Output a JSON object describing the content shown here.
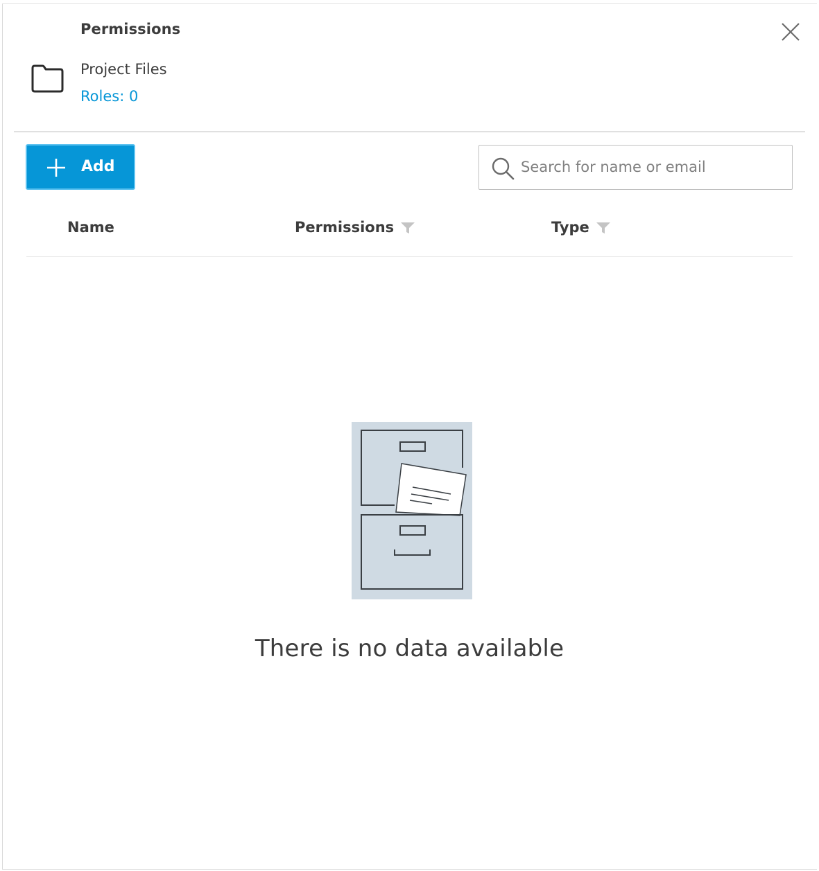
{
  "dialog": {
    "title": "Permissions",
    "close_icon": "close-icon"
  },
  "folder": {
    "icon": "folder-icon",
    "name": "Project Files",
    "roles_label": "Roles: 0"
  },
  "toolbar": {
    "add_icon": "plus-icon",
    "add_label": "Add",
    "search_icon": "search-icon",
    "search_placeholder": "Search for name or email",
    "search_value": ""
  },
  "table": {
    "columns": [
      {
        "label": "Name",
        "filterable": false
      },
      {
        "label": "Permissions",
        "filterable": true
      },
      {
        "label": "Type",
        "filterable": true
      }
    ],
    "rows": []
  },
  "empty_state": {
    "illustration": "file-cabinet-illustration",
    "message": "There is no data available"
  },
  "colors": {
    "accent": "#0696d7",
    "text": "#3c3c3c",
    "illustration_bg": "#cfdae3"
  }
}
